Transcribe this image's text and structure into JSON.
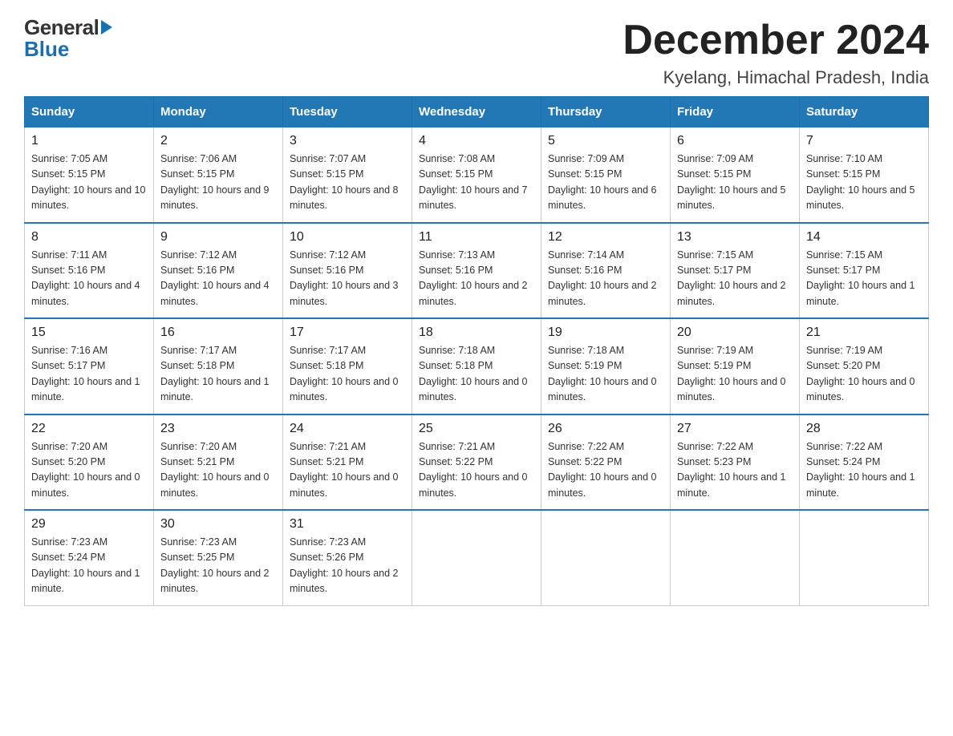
{
  "header": {
    "title": "December 2024",
    "subtitle": "Kyelang, Himachal Pradesh, India"
  },
  "logo": {
    "general": "General",
    "blue": "Blue"
  },
  "days_of_week": [
    "Sunday",
    "Monday",
    "Tuesday",
    "Wednesday",
    "Thursday",
    "Friday",
    "Saturday"
  ],
  "weeks": [
    [
      {
        "num": "1",
        "sunrise": "7:05 AM",
        "sunset": "5:15 PM",
        "daylight": "10 hours and 10 minutes."
      },
      {
        "num": "2",
        "sunrise": "7:06 AM",
        "sunset": "5:15 PM",
        "daylight": "10 hours and 9 minutes."
      },
      {
        "num": "3",
        "sunrise": "7:07 AM",
        "sunset": "5:15 PM",
        "daylight": "10 hours and 8 minutes."
      },
      {
        "num": "4",
        "sunrise": "7:08 AM",
        "sunset": "5:15 PM",
        "daylight": "10 hours and 7 minutes."
      },
      {
        "num": "5",
        "sunrise": "7:09 AM",
        "sunset": "5:15 PM",
        "daylight": "10 hours and 6 minutes."
      },
      {
        "num": "6",
        "sunrise": "7:09 AM",
        "sunset": "5:15 PM",
        "daylight": "10 hours and 5 minutes."
      },
      {
        "num": "7",
        "sunrise": "7:10 AM",
        "sunset": "5:15 PM",
        "daylight": "10 hours and 5 minutes."
      }
    ],
    [
      {
        "num": "8",
        "sunrise": "7:11 AM",
        "sunset": "5:16 PM",
        "daylight": "10 hours and 4 minutes."
      },
      {
        "num": "9",
        "sunrise": "7:12 AM",
        "sunset": "5:16 PM",
        "daylight": "10 hours and 4 minutes."
      },
      {
        "num": "10",
        "sunrise": "7:12 AM",
        "sunset": "5:16 PM",
        "daylight": "10 hours and 3 minutes."
      },
      {
        "num": "11",
        "sunrise": "7:13 AM",
        "sunset": "5:16 PM",
        "daylight": "10 hours and 2 minutes."
      },
      {
        "num": "12",
        "sunrise": "7:14 AM",
        "sunset": "5:16 PM",
        "daylight": "10 hours and 2 minutes."
      },
      {
        "num": "13",
        "sunrise": "7:15 AM",
        "sunset": "5:17 PM",
        "daylight": "10 hours and 2 minutes."
      },
      {
        "num": "14",
        "sunrise": "7:15 AM",
        "sunset": "5:17 PM",
        "daylight": "10 hours and 1 minute."
      }
    ],
    [
      {
        "num": "15",
        "sunrise": "7:16 AM",
        "sunset": "5:17 PM",
        "daylight": "10 hours and 1 minute."
      },
      {
        "num": "16",
        "sunrise": "7:17 AM",
        "sunset": "5:18 PM",
        "daylight": "10 hours and 1 minute."
      },
      {
        "num": "17",
        "sunrise": "7:17 AM",
        "sunset": "5:18 PM",
        "daylight": "10 hours and 0 minutes."
      },
      {
        "num": "18",
        "sunrise": "7:18 AM",
        "sunset": "5:18 PM",
        "daylight": "10 hours and 0 minutes."
      },
      {
        "num": "19",
        "sunrise": "7:18 AM",
        "sunset": "5:19 PM",
        "daylight": "10 hours and 0 minutes."
      },
      {
        "num": "20",
        "sunrise": "7:19 AM",
        "sunset": "5:19 PM",
        "daylight": "10 hours and 0 minutes."
      },
      {
        "num": "21",
        "sunrise": "7:19 AM",
        "sunset": "5:20 PM",
        "daylight": "10 hours and 0 minutes."
      }
    ],
    [
      {
        "num": "22",
        "sunrise": "7:20 AM",
        "sunset": "5:20 PM",
        "daylight": "10 hours and 0 minutes."
      },
      {
        "num": "23",
        "sunrise": "7:20 AM",
        "sunset": "5:21 PM",
        "daylight": "10 hours and 0 minutes."
      },
      {
        "num": "24",
        "sunrise": "7:21 AM",
        "sunset": "5:21 PM",
        "daylight": "10 hours and 0 minutes."
      },
      {
        "num": "25",
        "sunrise": "7:21 AM",
        "sunset": "5:22 PM",
        "daylight": "10 hours and 0 minutes."
      },
      {
        "num": "26",
        "sunrise": "7:22 AM",
        "sunset": "5:22 PM",
        "daylight": "10 hours and 0 minutes."
      },
      {
        "num": "27",
        "sunrise": "7:22 AM",
        "sunset": "5:23 PM",
        "daylight": "10 hours and 1 minute."
      },
      {
        "num": "28",
        "sunrise": "7:22 AM",
        "sunset": "5:24 PM",
        "daylight": "10 hours and 1 minute."
      }
    ],
    [
      {
        "num": "29",
        "sunrise": "7:23 AM",
        "sunset": "5:24 PM",
        "daylight": "10 hours and 1 minute."
      },
      {
        "num": "30",
        "sunrise": "7:23 AM",
        "sunset": "5:25 PM",
        "daylight": "10 hours and 2 minutes."
      },
      {
        "num": "31",
        "sunrise": "7:23 AM",
        "sunset": "5:26 PM",
        "daylight": "10 hours and 2 minutes."
      },
      null,
      null,
      null,
      null
    ]
  ]
}
